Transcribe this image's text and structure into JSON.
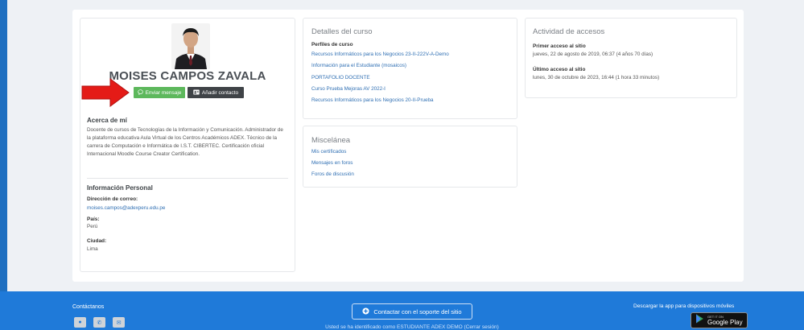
{
  "profile": {
    "name": "MOISES CAMPOS ZAVALA",
    "send_message_label": "Enviar mensaje",
    "add_contact_label": "Añadir contacto",
    "about_title": "Acerca de mí",
    "about_text": "Docente de cursos de Tecnologías de la Información y Comunicación. Administrador de la plataforma educativa Aula Virtual de los Centros Académicos ADEX. Técnico de la carrera de Computación e Informática de I.S.T. CIBERTEC. Certificación oficial Internacional Moodle Course Creator Certification.",
    "personal_title": "Información Personal",
    "email_label": "Dirección de correo:",
    "email_value": "moises.campos@adexperu.edu.pe",
    "country_label": "País:",
    "country_value": "Perú",
    "city_label": "Ciudad:",
    "city_value": "Lima"
  },
  "course_details": {
    "heading": "Detalles del curso",
    "subheading": "Perfiles de curso",
    "courses": [
      "Recursos Informáticos para los Negocios 23-II-222V-A-Demo",
      "Información para el Estudiante (mosaicos)",
      "PORTAFOLIO DOCENTE",
      "Curso Prueba Mejoras AV 2022-I",
      "Recursos Informáticos para los Negocios 20-II-Prueba"
    ]
  },
  "misc": {
    "heading": "Miscelánea",
    "links": [
      "Mis certificados",
      "Mensajes en foros",
      "Foros de discusión"
    ]
  },
  "access": {
    "heading": "Actividad de accesos",
    "first_label": "Primer acceso al sitio",
    "first_value": "jueves, 22 de agosto de 2019, 06:37  (4 años 70 días)",
    "last_label": "Último acceso al sitio",
    "last_value": "lunes, 30 de octubre de 2023, 16:44  (1 hora 33 minutos)"
  },
  "footer": {
    "contact_title": "Contáctanos",
    "support_button": "Contactar con el soporte del sitio",
    "logged_in_text": "Usted se ha identificado como ESTUDIANTE ADEX DEMO (Cerrar sesión)",
    "app_text": "Descargar la app para dispositivos móviles",
    "gplay_small": "GET IT ON",
    "gplay_big": "Google Play"
  },
  "colors": {
    "brand_blue": "#1f7ad9",
    "message_green": "#5db85c",
    "contact_dark": "#3f4347",
    "arrow_red": "#e41b17"
  }
}
